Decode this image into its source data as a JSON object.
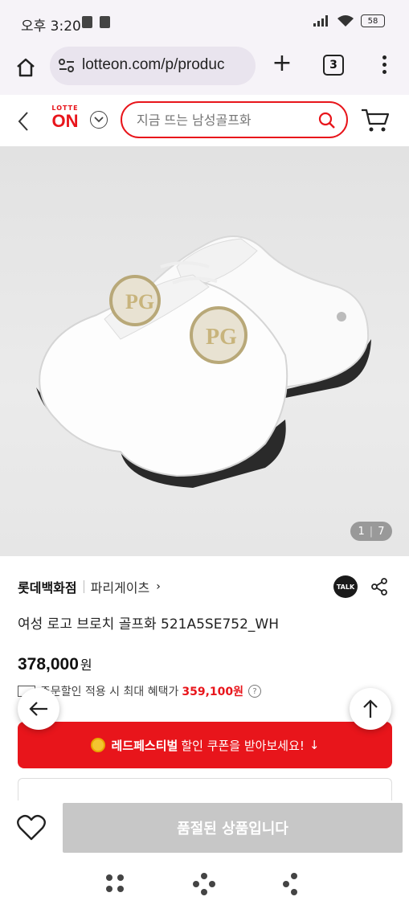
{
  "status_bar": {
    "time": "오후 3:20",
    "battery": "58"
  },
  "browser": {
    "url": "lotteon.com/p/produc",
    "plus_label": "+",
    "tab_count": "3"
  },
  "site_header": {
    "logo_top": "LOTTE",
    "logo_main": "ON",
    "search_placeholder": "지금 뜨는 남성골프화",
    "brand_color": "#e8151b"
  },
  "gallery": {
    "current_page": "1",
    "total_pages": "7",
    "separator": "|"
  },
  "product": {
    "seller": "롯데백화점",
    "brand": "파리게이츠",
    "brand_arrow": "›",
    "talk_label": "TALK",
    "title": "여성 로고 브로치 골프화 521A5SE752_WH",
    "price": "378,000",
    "price_unit": "원",
    "benefit_text": "주문할인 적용 시 최대 혜택가",
    "benefit_amount": "359,100원",
    "info_icon": "?"
  },
  "coupon": {
    "event_name": "레드페스티벌",
    "message": "할인 쿠폰을 받아보세요!",
    "arrow": "↓",
    "background_color": "#e8151b"
  },
  "action_bar": {
    "soldout_label": "품절된 상품입니다"
  },
  "icons": [
    "home-icon",
    "site-settings-icon",
    "plus-icon",
    "tabs-icon",
    "more-vert-icon",
    "back-chevron-icon",
    "chevron-down-icon",
    "search-icon",
    "cart-icon",
    "talk-icon",
    "share-icon",
    "arrow-left-icon",
    "arrow-up-icon",
    "coin-icon",
    "heart-icon"
  ]
}
